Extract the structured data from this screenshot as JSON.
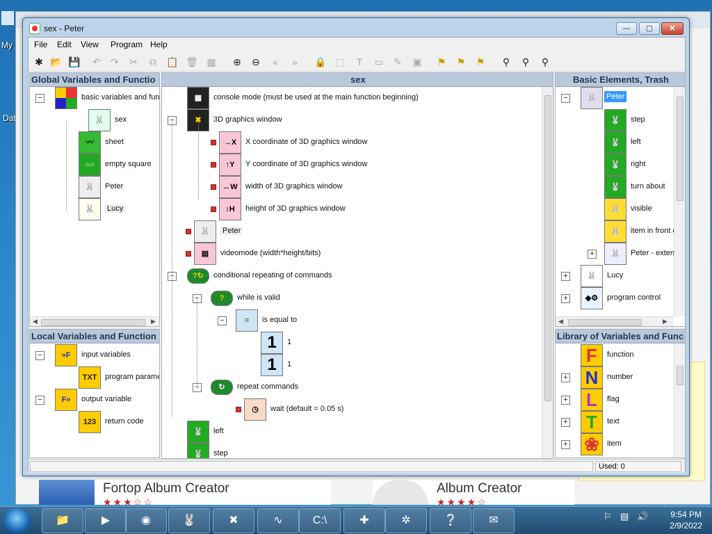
{
  "desktop": {
    "labels": [
      "My",
      "Dat"
    ]
  },
  "store": {
    "tiles": [
      {
        "name": "Fortop Album Creator",
        "stars": "★★★☆☆"
      },
      {
        "name": "Album Creator",
        "stars": "★★★★☆"
      }
    ]
  },
  "window": {
    "title": "sex - Peter",
    "min": "—",
    "max": "▢",
    "close": "✕",
    "menus": [
      "File",
      "Edit",
      "View",
      "Program",
      "Help"
    ]
  },
  "toolbar": [
    {
      "name": "tree-icon",
      "g": "✱",
      "c": ""
    },
    {
      "name": "open-icon",
      "g": "📂",
      "c": ""
    },
    {
      "name": "save-icon",
      "g": "💾",
      "c": "blue"
    },
    {
      "name": "undo-icon",
      "g": "↶",
      "c": "dis"
    },
    {
      "name": "redo-icon",
      "g": "↷",
      "c": "dis"
    },
    {
      "name": "cut-icon",
      "g": "✂",
      "c": "dis"
    },
    {
      "name": "copy-icon",
      "g": "⧉",
      "c": "dis"
    },
    {
      "name": "paste-icon",
      "g": "📋",
      "c": "dis"
    },
    {
      "name": "delete-icon",
      "g": "🗑",
      "c": "dis"
    },
    {
      "name": "select-icon",
      "g": "▦",
      "c": "dis"
    },
    {
      "name": "zoom-in-icon",
      "g": "⊕",
      "c": ""
    },
    {
      "name": "zoom-out-icon",
      "g": "⊖",
      "c": ""
    },
    {
      "name": "back-icon",
      "g": "«",
      "c": "dis"
    },
    {
      "name": "forward-icon",
      "g": "»",
      "c": "dis"
    },
    {
      "name": "lock-icon",
      "g": "🔒",
      "c": "blue"
    },
    {
      "name": "frame-icon",
      "g": "⬚",
      "c": "dis"
    },
    {
      "name": "text-icon",
      "g": "T",
      "c": "dis"
    },
    {
      "name": "textbox-icon",
      "g": "▭",
      "c": "dis"
    },
    {
      "name": "edit-icon",
      "g": "✎",
      "c": "dis"
    },
    {
      "name": "window-icon",
      "g": "▣",
      "c": "dis"
    },
    {
      "name": "find1-icon",
      "g": "⚑",
      "c": "gold"
    },
    {
      "name": "find2-icon",
      "g": "⚑",
      "c": "gold"
    },
    {
      "name": "find3-icon",
      "g": "⚑",
      "c": "gold"
    },
    {
      "name": "binoculars-icon",
      "g": "⚲",
      "c": ""
    },
    {
      "name": "search-next-icon",
      "g": "⚲",
      "c": ""
    },
    {
      "name": "search-prev-icon",
      "g": "⚲",
      "c": ""
    }
  ],
  "panels": {
    "global": "Global Variables and Functio",
    "sex": "sex",
    "basic": "Basic Elements, Trash",
    "local": "Local Variables and Function",
    "library": "Library of Variables and Func"
  },
  "global_items": [
    {
      "label": "basic variables and fun",
      "icon": "grid-icon"
    },
    {
      "label": "sex",
      "icon": "rabbit-icon"
    },
    {
      "label": "sheet",
      "icon": "sheet-icon"
    },
    {
      "label": "empty square",
      "icon": "square-icon"
    },
    {
      "label": "Peter",
      "icon": "rabbit-icon"
    },
    {
      "label": "Lucy",
      "icon": "rabbit-icon"
    }
  ],
  "local_items": [
    {
      "label": "input variables",
      "icon": "function-icon"
    },
    {
      "label": "program parame",
      "icon": "text-icon"
    },
    {
      "label": "output variable",
      "icon": "function-icon"
    },
    {
      "label": "return code",
      "icon": "number-icon"
    }
  ],
  "sex_items": [
    {
      "label": "console mode (must be used at the main function beginning)"
    },
    {
      "label": "3D graphics window"
    },
    {
      "label": "X coordinate of 3D graphics window"
    },
    {
      "label": "Y coordinate of 3D graphics window"
    },
    {
      "label": "width of 3D graphics window"
    },
    {
      "label": "height of 3D graphics window"
    },
    {
      "label": "Peter"
    },
    {
      "label": "videomode (width*height/bits)"
    },
    {
      "label": "conditional repeating of commands"
    },
    {
      "label": "while is valid"
    },
    {
      "label": "is equal to"
    },
    {
      "label": "1"
    },
    {
      "label": "1"
    },
    {
      "label": "repeat commands"
    },
    {
      "label": "wait (default = 0.05 s)"
    },
    {
      "label": "left"
    },
    {
      "label": "step"
    }
  ],
  "basic_items": [
    {
      "label": "Peter"
    },
    {
      "label": "step"
    },
    {
      "label": "left"
    },
    {
      "label": "right"
    },
    {
      "label": "turn about"
    },
    {
      "label": "visible"
    },
    {
      "label": "item in front o"
    },
    {
      "label": "Peter - exten"
    },
    {
      "label": "Lucy"
    },
    {
      "label": "program control"
    }
  ],
  "library_items": [
    {
      "label": "function",
      "letter": "F"
    },
    {
      "label": "number",
      "letter": "N"
    },
    {
      "label": "flag",
      "letter": "L"
    },
    {
      "label": "text",
      "letter": "T"
    },
    {
      "label": "item",
      "letter": "❀"
    }
  ],
  "status": {
    "used": "Used: 0"
  },
  "taskbar": {
    "items": [
      "explorer",
      "media",
      "chrome",
      "peter",
      "console3d",
      "oscilloscope",
      "cmd",
      "puzzle",
      "gallery",
      "help",
      "notes"
    ],
    "time": "9:54 PM",
    "date": "2/9/2022"
  },
  "colors": {
    "header": "#b9c9db",
    "selected": "#3399ff",
    "red": "#d8312d",
    "green": "#1e8a2a"
  }
}
